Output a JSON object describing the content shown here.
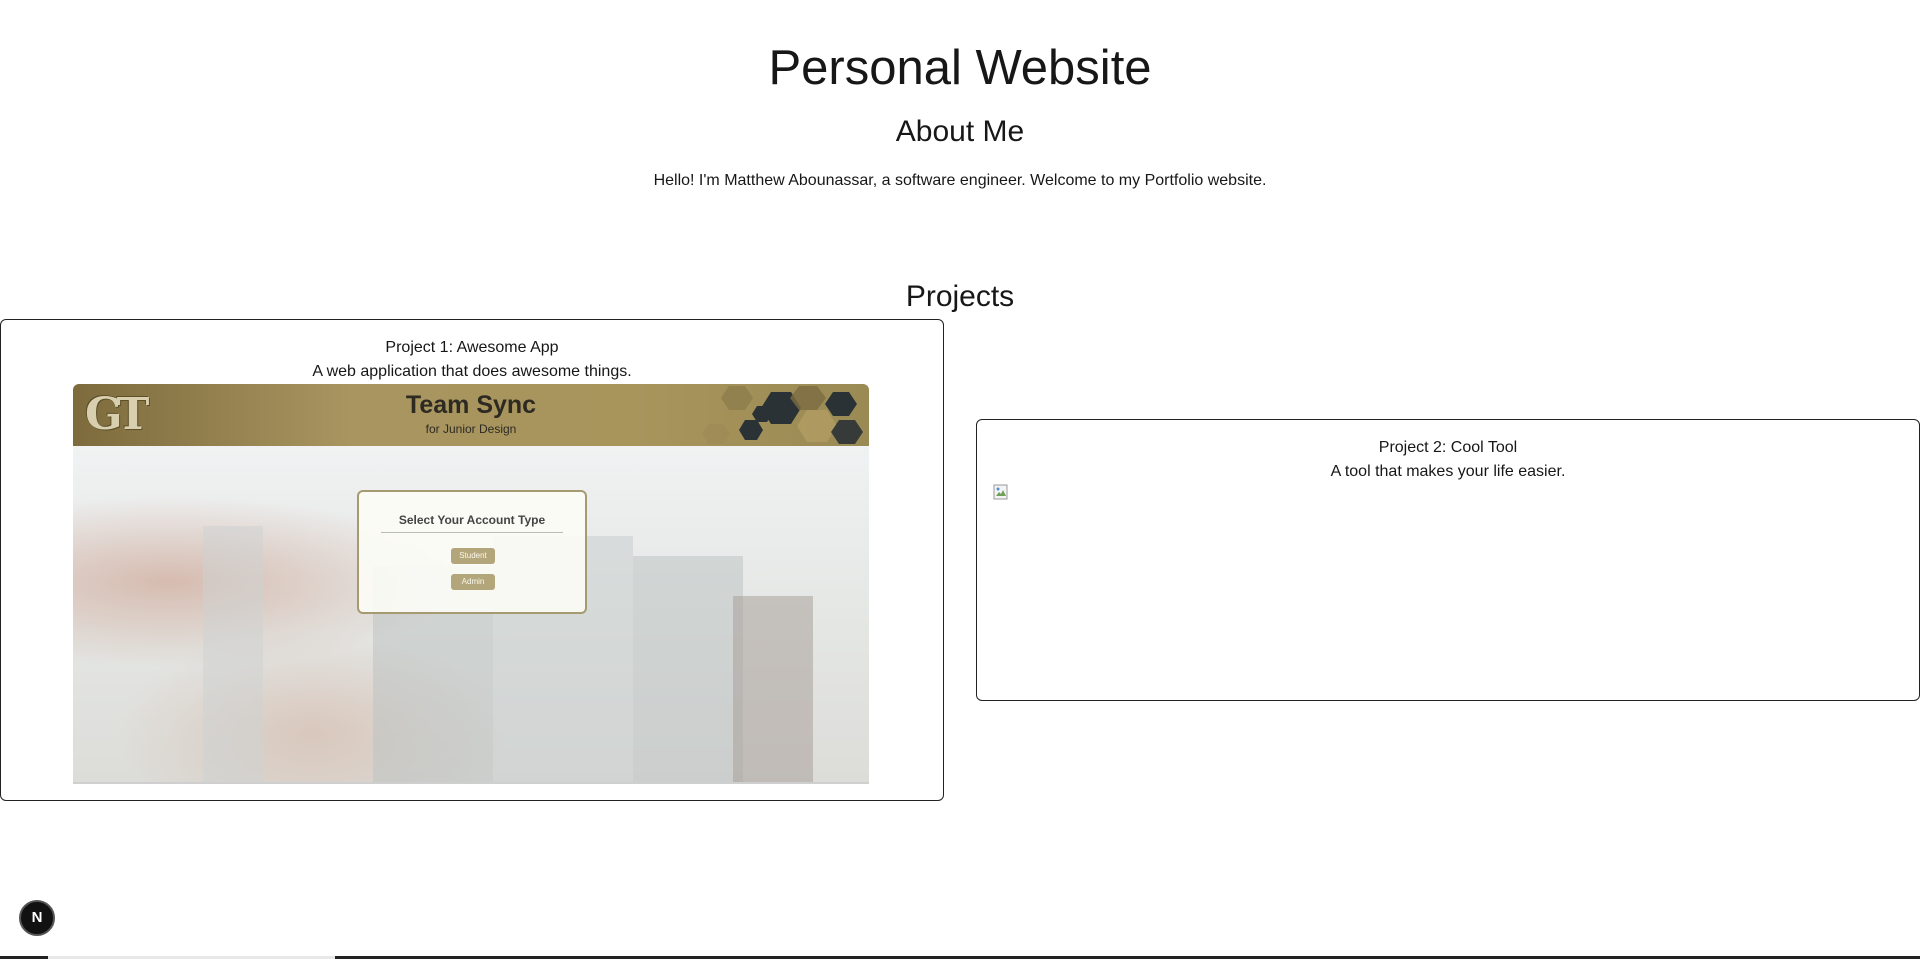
{
  "header": {
    "title": "Personal Website",
    "about_heading": "About Me",
    "about_text": "Hello! I'm Matthew Abounassar, a software engineer. Welcome to my Portfolio website."
  },
  "projects": {
    "heading": "Projects",
    "items": [
      {
        "title": "Project 1: Awesome App",
        "description": "A web application that does awesome things.",
        "screenshot": {
          "logo": "GT",
          "app_title": "Team Sync",
          "app_subtitle": "for Junior Design",
          "dialog_title": "Select Your Account Type",
          "buttons": [
            "Student",
            "Admin"
          ]
        }
      },
      {
        "title": "Project 2: Cool Tool",
        "description": "A tool that makes your life easier.",
        "image": "broken-image-icon"
      }
    ]
  },
  "dev_badge": {
    "label": "N",
    "icon": "nextjs-icon"
  },
  "colors": {
    "text": "#171717",
    "card_border": "#222222",
    "gt_gold": "#a8955c",
    "button_gold": "#b3a67b"
  }
}
